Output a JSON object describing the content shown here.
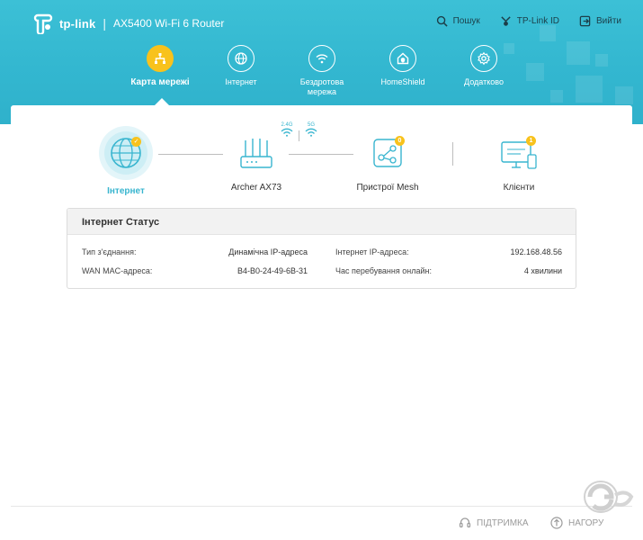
{
  "header": {
    "brand": "tp-link",
    "separator": "|",
    "model": "AX5400 Wi-Fi 6 Router",
    "actions": [
      {
        "label": "Пошук",
        "icon": "search-icon"
      },
      {
        "label": "TP-Link ID",
        "icon": "tplink-id-icon"
      },
      {
        "label": "Вийти",
        "icon": "logout-icon"
      }
    ]
  },
  "nav": {
    "items": [
      {
        "label": "Карта мережі",
        "icon": "network-map-icon",
        "active": true
      },
      {
        "label": "Інтернет",
        "icon": "globe-icon"
      },
      {
        "label": "Бездротова мережа",
        "icon": "wifi-icon"
      },
      {
        "label": "HomeShield",
        "icon": "homeshield-icon"
      },
      {
        "label": "Додатково",
        "icon": "advanced-gear-icon"
      }
    ]
  },
  "topology": {
    "internet_label": "Інтернет",
    "router_label": "Archer AX73",
    "band_24": "2.4G",
    "band_5": "5G",
    "mesh_label": "Пристрої Mesh",
    "mesh_count": "0",
    "clients_label": "Клієнти",
    "clients_count": "1"
  },
  "status": {
    "title": "Інтернет Статус",
    "connection_type_label": "Тип з'єднання:",
    "connection_type_value": "Динамічна IP-адреса",
    "wan_mac_label": "WAN MAC-адреса:",
    "wan_mac_value": "B4-B0-24-49-6B-31",
    "internet_ip_label": "Інтернет IP-адреса:",
    "internet_ip_value": "192.168.48.56",
    "online_time_label": "Час перебування онлайн:",
    "online_time_value": "4 хвилини"
  },
  "footer": {
    "support_label": "ПІДТРИМКА",
    "top_label": "НАГОРУ"
  },
  "colors": {
    "header": "#3cc0d6",
    "accent": "#38b5cf",
    "active_nav": "#f8c21c"
  }
}
